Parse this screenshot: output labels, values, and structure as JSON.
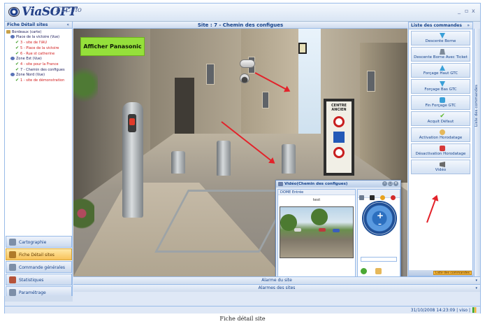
{
  "app": {
    "logo_text": "ViaSOFT",
    "logo_sub": "ETC.ho",
    "window_controls": [
      "_",
      "▫",
      "x"
    ]
  },
  "left_panel": {
    "title": "Fiche Détail sites",
    "tree": [
      {
        "label": "Bordeaux (carte)",
        "level": 0,
        "icon": "folder-icon"
      },
      {
        "label": "Place de la victoire (Vue)",
        "level": 1,
        "icon": "camera-icon"
      },
      {
        "label": "3 - site de l'IAU",
        "level": 2,
        "icon": "check-icon",
        "alert": true
      },
      {
        "label": "5 - Place de la victoire",
        "level": 2,
        "icon": "check-icon",
        "alert": true
      },
      {
        "label": "6 - Rue st catherine",
        "level": 2,
        "icon": "check-icon",
        "alert": true
      },
      {
        "label": "Zone Est (Vue)",
        "level": 1,
        "icon": "camera-icon"
      },
      {
        "label": "4 - site pour la France",
        "level": 2,
        "icon": "check-icon",
        "alert": true
      },
      {
        "label": "7 - Chemin des configues",
        "level": 2,
        "icon": "check-icon",
        "alert": false
      },
      {
        "label": "Zone Nord (Vue)",
        "level": 1,
        "icon": "camera-icon"
      },
      {
        "label": "1 - site de démonstration",
        "level": 2,
        "icon": "check-icon",
        "alert": true
      }
    ],
    "nav": [
      {
        "label": "Cartographie",
        "icon": "map-icon",
        "active": false
      },
      {
        "label": "Fiche Détail sites",
        "icon": "site-icon",
        "active": true
      },
      {
        "label": "Commande générales",
        "icon": "command-icon",
        "active": false
      },
      {
        "label": "Statistiques",
        "icon": "stats-icon",
        "active": false
      },
      {
        "label": "Paramétrage",
        "icon": "settings-icon",
        "active": false
      }
    ]
  },
  "center": {
    "site_title": "Site : 7 - Chemin des configues",
    "banner": "Afficher Panasonic"
  },
  "video_popup": {
    "title": "Vidéo(Chemin des configues)",
    "camera_name": "DOME Entrée",
    "status_text": "test"
  },
  "commands": {
    "title": "Liste des commandes",
    "items": [
      {
        "label": "Descente Borne",
        "icon": "down-arrow-icon",
        "color": "#3aa0d8"
      },
      {
        "label": "Descente Borne Avec Ticket",
        "icon": "ticket-icon",
        "color": "#7d8a99"
      },
      {
        "label": "Forçage Haut GTC",
        "icon": "up-arrow-icon",
        "color": "#3aa0d8"
      },
      {
        "label": "Forçage Bas GTC",
        "icon": "down-arrow-icon",
        "color": "#3aa0d8"
      },
      {
        "label": "Fin Forçage GTC",
        "icon": "stop-force-icon",
        "color": "#3aa0d8"
      },
      {
        "label": "Acquit Défaut",
        "icon": "check-icon",
        "color": "#5cb82b"
      },
      {
        "label": "Activation Horodatage",
        "icon": "clock-icon",
        "color": "#e6b85a"
      },
      {
        "label": "Désactivation Horodatage",
        "icon": "clock-off-icon",
        "color": "#d63a3a"
      },
      {
        "label": "Vidéo",
        "icon": "video-icon",
        "color": "#6a6a6a"
      }
    ],
    "vertical_tab": "Liste des commandes",
    "footer_tag": "Liste des commandes"
  },
  "bottom": {
    "alarm_site": "Alarme du site",
    "alarm_sites": "Alarmes des sites"
  },
  "status_bar": {
    "text": "31/10/2008 14:23:09 | viso |"
  },
  "caption": "Fiche détail site"
}
